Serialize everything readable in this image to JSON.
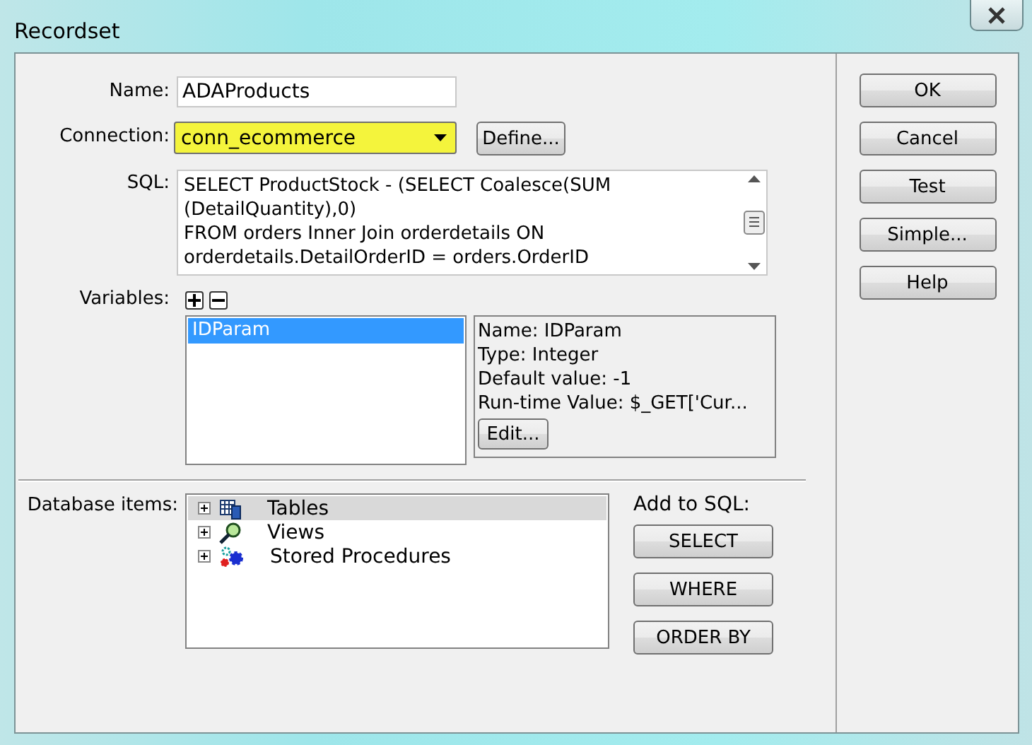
{
  "window": {
    "title": "Recordset"
  },
  "name": {
    "label": "Name:",
    "value": "ADAProducts"
  },
  "connection": {
    "label": "Connection:",
    "value": "conn_ecommerce",
    "highlighted": true
  },
  "define_button": "Define...",
  "sql": {
    "label": "SQL:",
    "lines": [
      "SELECT ProductStock - (SELECT Coalesce(SUM",
      "(DetailQuantity),0)",
      "FROM orders Inner Join orderdetails ON",
      "orderdetails.DetailOrderID = orders.OrderID"
    ]
  },
  "variables": {
    "label": "Variables:",
    "items": [
      {
        "name": "IDParam",
        "selected": true
      }
    ],
    "details": [
      "Name: IDParam",
      "Type: Integer",
      "Default value: -1",
      "Run-time Value: $_GET['Cur..."
    ],
    "edit_button": "Edit..."
  },
  "database_items": {
    "label": "Database items:",
    "tree": [
      {
        "label": "Tables",
        "kind": "tables",
        "selected": true,
        "expanded": false
      },
      {
        "label": "Views",
        "kind": "views",
        "selected": false,
        "expanded": false
      },
      {
        "label": "Stored Procedures",
        "kind": "procedures",
        "selected": false,
        "expanded": false
      }
    ]
  },
  "add_to_sql": {
    "label": "Add to SQL:",
    "buttons": [
      "SELECT",
      "WHERE",
      "ORDER BY"
    ]
  },
  "buttons": [
    "OK",
    "Cancel",
    "Test",
    "Simple...",
    "Help"
  ]
}
